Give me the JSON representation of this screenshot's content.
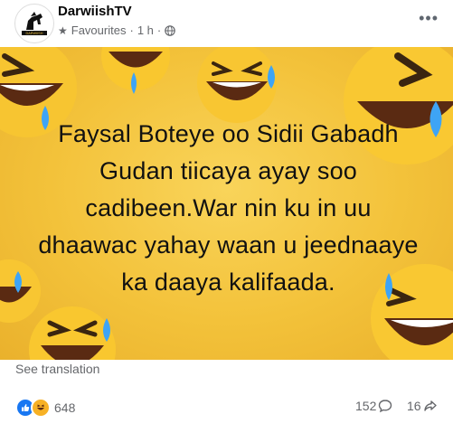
{
  "post": {
    "page_name": "DarwiishTV",
    "audience_label": "Favourites",
    "separator": "·",
    "time": "1 h",
    "separator2": "·",
    "more_label": "•••",
    "avatar_text": "DARWIISH",
    "image_text": "Faysal Boteye oo Sidii Gabadh Gudan tiicaya ayay soo cadibeen.War nin ku in uu dhaawac yahay waan u jeednaaye ka daaya kalifaada.",
    "see_translation": "See translation"
  },
  "engagement": {
    "reaction_count": "648",
    "comment_count": "152",
    "share_count": "16"
  },
  "colors": {
    "background_yellow": "#f3c23a",
    "like_blue": "#1877f2",
    "haha_yellow": "#f7b125",
    "secondary_text": "#65676b"
  },
  "icons": [
    "star-icon",
    "globe-icon",
    "more-icon",
    "like-reaction-icon",
    "haha-reaction-icon",
    "comment-icon",
    "share-icon"
  ]
}
